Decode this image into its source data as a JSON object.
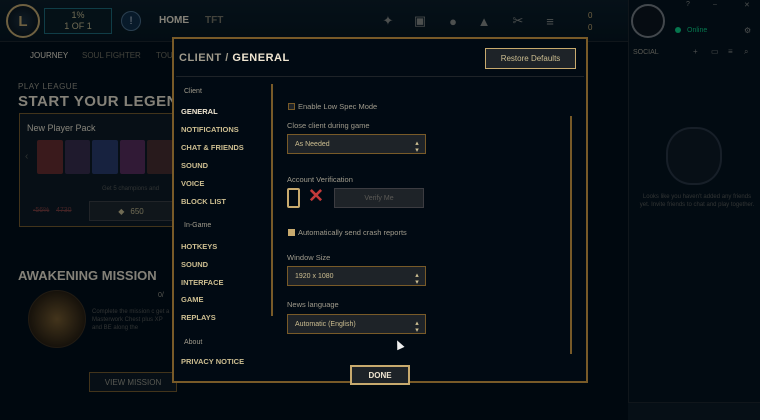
{
  "topbar": {
    "logo_letter": "L",
    "play": {
      "line1": "1%",
      "line2": "1 OF 1"
    },
    "tabs": [
      "HOME",
      "TFT"
    ],
    "icons": [
      "store-icon",
      "collection-icon",
      "profile-icon",
      "loot-icon",
      "crafting-icon",
      "rp-icon"
    ],
    "currency": {
      "be": "0",
      "rp": "0"
    }
  },
  "subnav": [
    "JOURNEY",
    "SOUL FIGHTER",
    "TOU"
  ],
  "home": {
    "play_label": "PLAY LEAGUE",
    "headline": "START YOUR LEGEND",
    "pack_title": "New Player Pack",
    "pack_text": "Get 5 champions and",
    "price_old1": "-56%",
    "price_old2": "4730",
    "price": "650",
    "awaken_title": "AWAKENING MISSION",
    "progress": "0/",
    "awaken_text": "Complete the mission c get a Masterwork Chest plus XP and BE along the",
    "view_button": "VIEW MISSION"
  },
  "social": {
    "status": "Online",
    "title": "SOCIAL",
    "empty_text": "Looks like you haven't added any friends yet. Invite friends to chat and play together."
  },
  "modal": {
    "title_prefix": "CLIENT /",
    "title_section": "GENERAL",
    "restore_label": "Restore Defaults",
    "nav": [
      {
        "group": "Client",
        "items": [
          "GENERAL",
          "NOTIFICATIONS",
          "CHAT & FRIENDS",
          "SOUND",
          "VOICE",
          "BLOCK LIST"
        ]
      },
      {
        "group": "In-Game",
        "items": [
          "HOTKEYS",
          "SOUND",
          "INTERFACE",
          "GAME",
          "REPLAYS"
        ]
      },
      {
        "group": "About",
        "items": [
          "PRIVACY NOTICE"
        ]
      }
    ],
    "settings": {
      "low_spec": {
        "label": "Enable Low Spec Mode",
        "checked": false
      },
      "close_client": {
        "label": "Close client during game",
        "value": "As Needed"
      },
      "account_verification": {
        "label": "Account Verification",
        "button": "Verify Me"
      },
      "crash_reports": {
        "label": "Automatically send crash reports",
        "checked": true
      },
      "window_size": {
        "label": "Window Size",
        "value": "1920 x 1080"
      },
      "news_language": {
        "label": "News language",
        "value": "Automatic (English)"
      }
    },
    "done_label": "DONE"
  },
  "colors": {
    "gold": "#c8aa6e",
    "dark_gold": "#785a28",
    "bg": "#010a13",
    "cream": "#f0e6d2",
    "online": "#0acf83",
    "danger": "#c23a3a"
  }
}
